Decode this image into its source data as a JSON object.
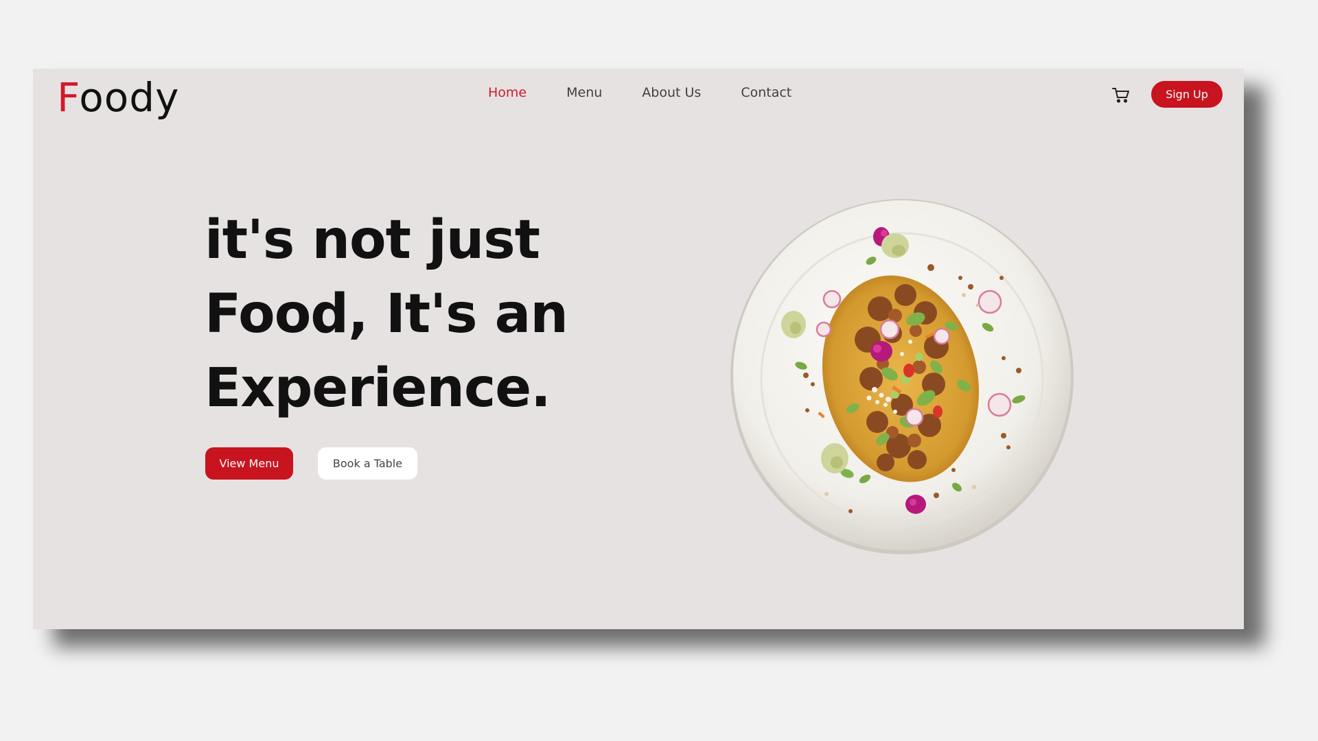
{
  "brand": {
    "logo_first": "F",
    "logo_rest": "oody",
    "accent_color": "#d11a2a"
  },
  "nav": {
    "items": [
      {
        "label": "Home",
        "active": true
      },
      {
        "label": "Menu",
        "active": false
      },
      {
        "label": "About Us",
        "active": false
      },
      {
        "label": "Contact",
        "active": false
      }
    ]
  },
  "header": {
    "cart_icon": "cart-icon",
    "signup_label": "Sign Up"
  },
  "hero": {
    "title_lines": [
      "it's not just",
      "Food, It's an",
      "Experience."
    ],
    "primary_button": "View Menu",
    "secondary_button": "Book a Table",
    "image": "plate-of-food"
  },
  "colors": {
    "background": "#f2f2f2",
    "panel": "#e7e2e2",
    "primary": "#c8141f",
    "text": "#111111"
  }
}
